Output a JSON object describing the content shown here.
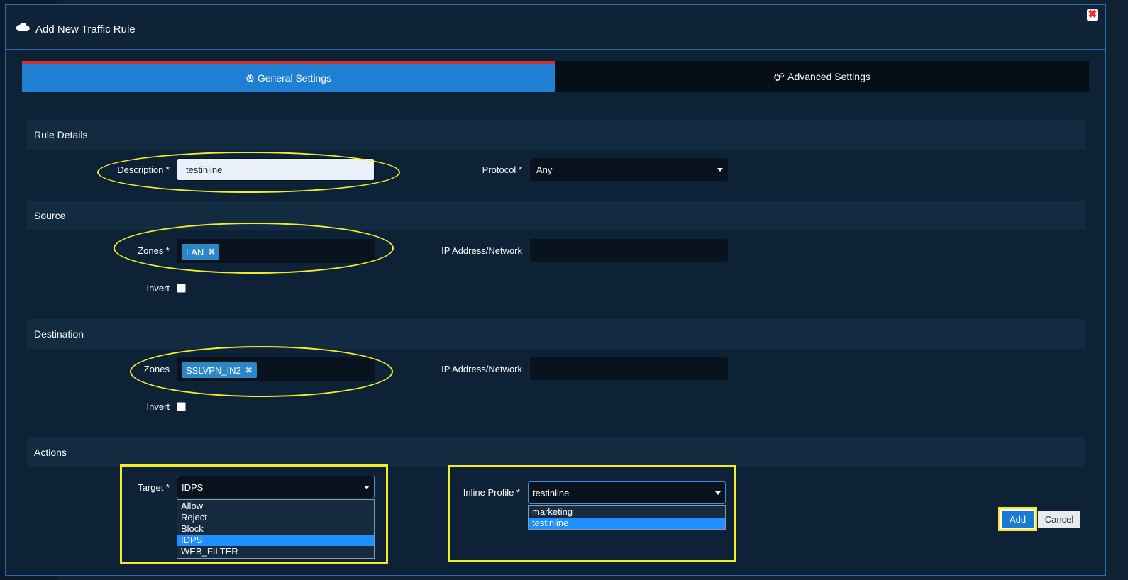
{
  "dialog": {
    "title": "Add New Traffic Rule",
    "close_icon": "close-icon"
  },
  "tabs": [
    {
      "label": "General Settings",
      "icon": "gear-icon",
      "active": true
    },
    {
      "label": "Advanced Settings",
      "icon": "gears-icon",
      "active": false
    }
  ],
  "rule_details": {
    "heading": "Rule Details",
    "description_label": "Description *",
    "description_value": "testinline",
    "protocol_label": "Protocol *",
    "protocol_value": "Any"
  },
  "source": {
    "heading": "Source",
    "zones_label": "Zones *",
    "zones_tags": [
      "LAN"
    ],
    "ip_label": "IP Address/Network",
    "ip_value": "",
    "invert_label": "Invert",
    "invert_checked": false
  },
  "destination": {
    "heading": "Destination",
    "zones_label": "Zones",
    "zones_tags": [
      "SSLVPN_IN2"
    ],
    "ip_label": "IP Address/Network",
    "ip_value": "",
    "invert_label": "Invert",
    "invert_checked": false
  },
  "actions": {
    "heading": "Actions",
    "target_label": "Target *",
    "target_value": "IDPS",
    "target_options": [
      "Allow",
      "Reject",
      "Block",
      "IDPS",
      "WEB_FILTER"
    ],
    "target_selected_index": 3,
    "inline_profile_label": "Inline Profile *",
    "inline_profile_value": "testinline",
    "inline_profile_options": [
      "marketing",
      "testinline"
    ],
    "inline_profile_selected_index": 1
  },
  "buttons": {
    "add_label": "Add",
    "cancel_label": "Cancel"
  },
  "colors": {
    "accent": "#1f7fd3",
    "tab_top_border": "#d8302c",
    "highlight": "#f4ee2a",
    "selected_option": "#1e90ff"
  }
}
